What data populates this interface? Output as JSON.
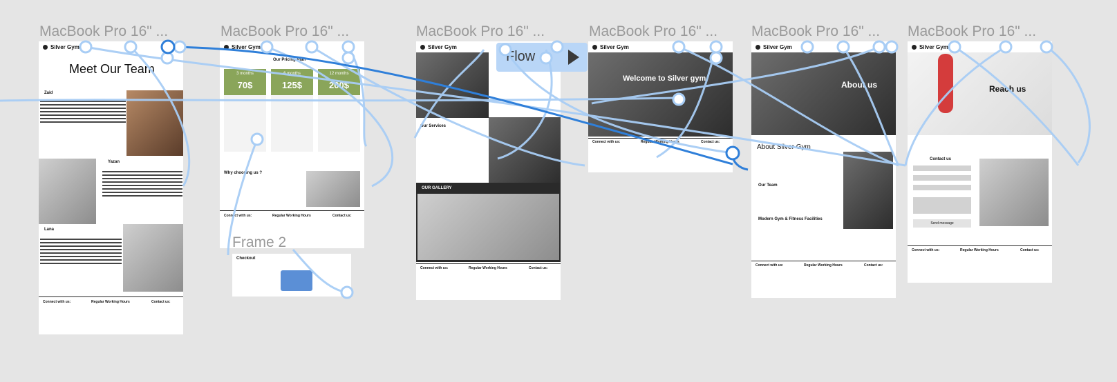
{
  "frames": [
    {
      "title": "MacBook Pro 16\" ...",
      "heading": "Meet Our Team",
      "members": [
        "Zaid",
        "Yazan",
        "Lana"
      ]
    },
    {
      "title": "MacBook Pro 16\" ...",
      "heading": "Our Pricing Plan",
      "plans": [
        {
          "duration": "3 months",
          "price": "70$"
        },
        {
          "duration": "6 months",
          "price": "125$"
        },
        {
          "duration": "12 months",
          "price": "200$"
        }
      ],
      "why": "Why choosing us ?"
    },
    {
      "title": "MacBook Pro 16\" ...",
      "services": "Our Services",
      "gallery": "OUR GALLERY"
    },
    {
      "title": "MacBook Pro 16\" ...",
      "hero": "Welcome to Silver gym"
    },
    {
      "title": "MacBook Pro 16\" ...",
      "hero": "About us",
      "about": "About Silver Gym",
      "team": "Our Team",
      "facilities": "Modern Gym & Fitness Facilities"
    },
    {
      "title": "MacBook Pro 16\" ...",
      "hero": "Reach us",
      "contact": "Contact us",
      "send": "Send message"
    }
  ],
  "brand": "Silver Gym",
  "footer": {
    "connect": "Connect with us:",
    "hours": "Regular Working Hours",
    "contact": "Contact us:"
  },
  "flow_label": "Flow",
  "frame2": {
    "title": "Frame 2",
    "checkout": "Checkout"
  },
  "colors": {
    "canvas": "#e5e5e5",
    "connector": "#a8cdf5",
    "connector_active": "#2f7fd9",
    "price_green": "#8aa55a"
  }
}
